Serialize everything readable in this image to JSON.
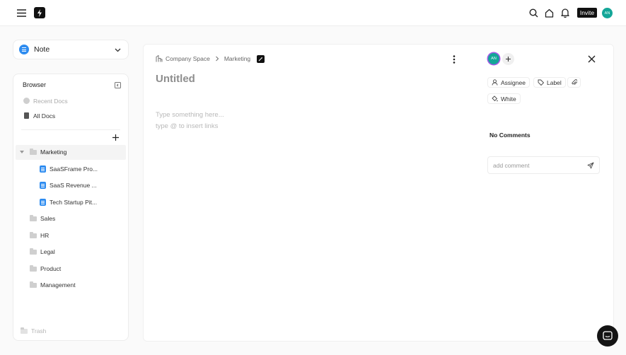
{
  "topbar": {
    "menu_icon": "hamburger-icon",
    "logo_icon": "bolt-logo",
    "search_icon": "search-icon",
    "home_icon": "home-icon",
    "bell_icon": "bell-icon",
    "invite_label": "Invite",
    "avatar_initials": "AN"
  },
  "note_select": {
    "label": "Note"
  },
  "browser": {
    "title": "Browser",
    "recent_docs": "Recent Docs",
    "all_docs": "All Docs",
    "folders": [
      {
        "name": "Marketing",
        "expanded": true,
        "docs": [
          "SaaSFrame Pro...",
          "SaaS Revenue ...",
          "Tech Startup Pit..."
        ]
      },
      {
        "name": "Sales"
      },
      {
        "name": "HR"
      },
      {
        "name": "Legal"
      },
      {
        "name": "Product"
      },
      {
        "name": "Management"
      }
    ],
    "trash": "Trash"
  },
  "editor": {
    "breadcrumb": [
      "Company Space",
      "Marketing"
    ],
    "title_placeholder": "Untitled",
    "body_placeholder_1": "Type something here...",
    "body_placeholder_2": "type @ to insert links"
  },
  "side": {
    "avatar_initials": "AN",
    "assignee_label": "Assignee",
    "label_label": "Label",
    "color_label": "White",
    "no_comments": "No Comments",
    "comment_placeholder": "add comment"
  },
  "colors": {
    "accent": "#2e8cf0",
    "avatar": "#14a698",
    "invite_bg": "#111111"
  }
}
